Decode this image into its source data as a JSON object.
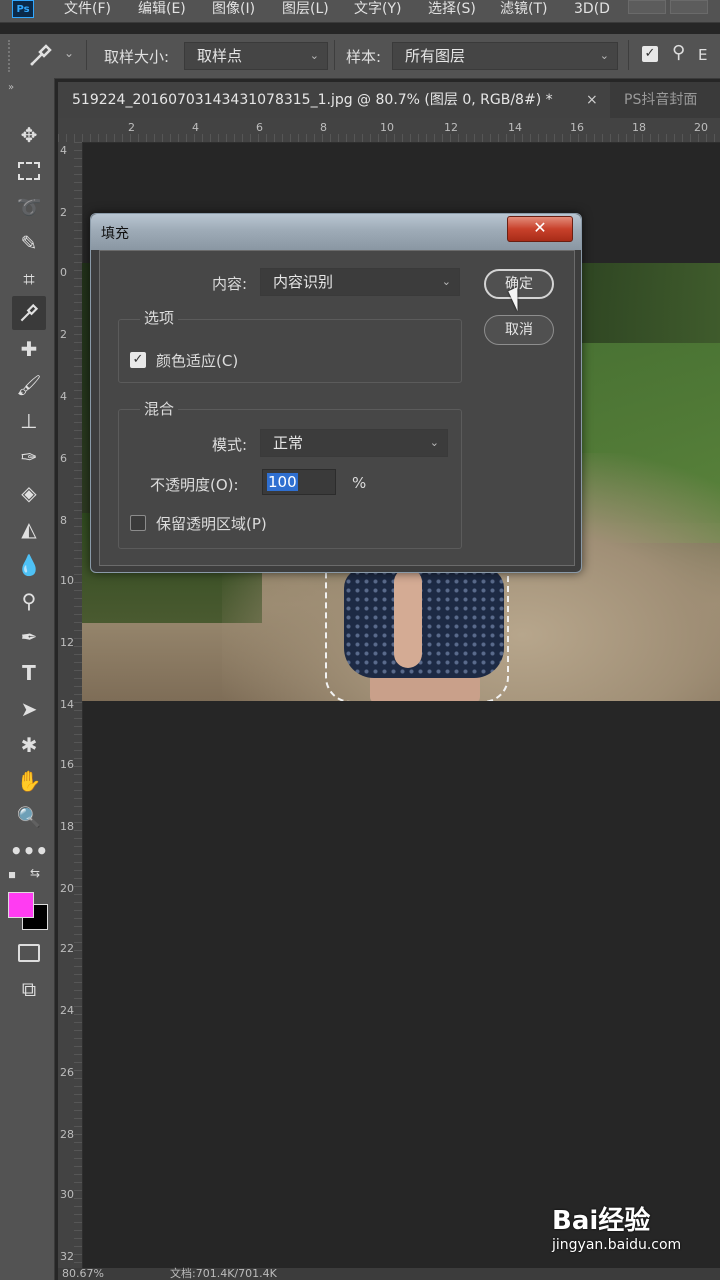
{
  "app": {
    "logo": "Ps"
  },
  "menu": [
    "文件(F)",
    "编辑(E)",
    "图像(I)",
    "图层(L)",
    "文字(Y)",
    "选择(S)",
    "滤镜(T)",
    "3D(D"
  ],
  "options": {
    "sample_size_label": "取样大小:",
    "sample_size_value": "取样点",
    "sample_label": "样本:",
    "sample_value": "所有图层",
    "right_text": "E"
  },
  "tabs": [
    {
      "label": "519224_20160703143431078315_1.jpg @ 80.7% (图层 0, RGB/8#) *",
      "close": "×"
    },
    {
      "label": "PS抖音封面"
    }
  ],
  "ruler": {
    "top": [
      "2",
      "4",
      "6",
      "8",
      "10",
      "12",
      "14",
      "16",
      "18",
      "20"
    ],
    "left": [
      "4",
      "2",
      "0",
      "2",
      "4",
      "6",
      "8",
      "10",
      "12",
      "14",
      "16",
      "18",
      "20",
      "22",
      "24",
      "26",
      "28",
      "30",
      "32"
    ]
  },
  "toolbar": {
    "icons": [
      "move-icon",
      "marquee-icon",
      "lasso-icon",
      "quick-select-icon",
      "crop-icon",
      "eyedropper-icon",
      "healing-icon",
      "brush-icon",
      "stamp-icon",
      "history-brush-icon",
      "eraser-icon",
      "paint-bucket-icon",
      "blur-icon",
      "dodge-icon",
      "pen-icon",
      "type-icon",
      "path-select-icon",
      "shape-icon",
      "hand-icon",
      "zoom-icon",
      "more-icon"
    ],
    "foreground": "#ff3cf2",
    "background": "#000000"
  },
  "dialog": {
    "title": "填充",
    "close": "✕",
    "content_label": "内容:",
    "content_value": "内容识别",
    "ok": "确定",
    "cancel": "取消",
    "options_title": "选项",
    "color_adapt": {
      "label": "颜色适应(C)",
      "checked": true
    },
    "blend_title": "混合",
    "mode_label": "模式:",
    "mode_value": "正常",
    "opacity_label": "不透明度(O):",
    "opacity_value": "100",
    "opacity_unit": "%",
    "preserve": {
      "label": "保留透明区域(P)",
      "checked": false
    }
  },
  "status": {
    "zoom": "80.67%",
    "doc": "文档:701.4K/701.4K"
  },
  "watermark": {
    "logo": "Bai经验",
    "url": "jingyan.baidu.com"
  }
}
